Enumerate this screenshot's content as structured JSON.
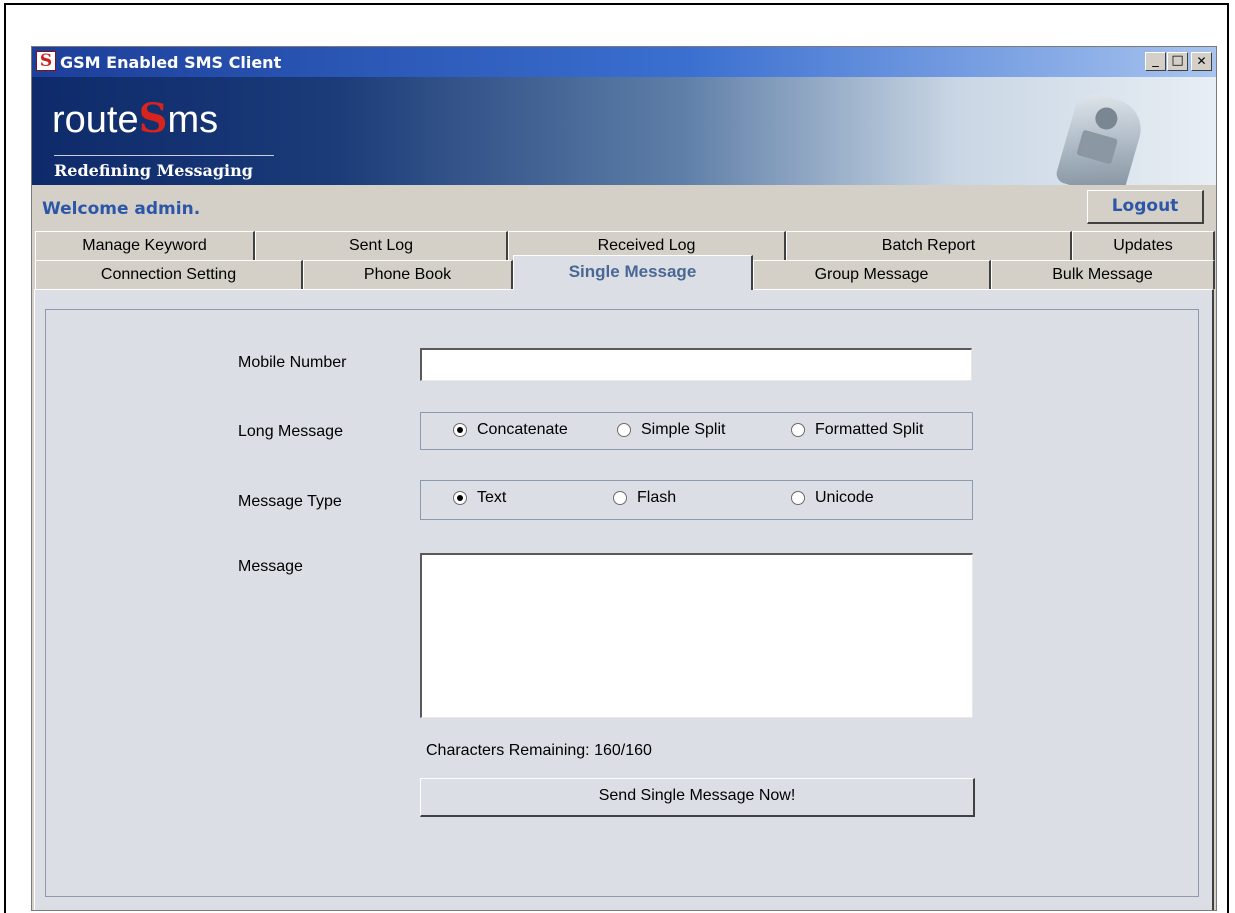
{
  "window": {
    "title": "GSM Enabled SMS Client",
    "app_icon": "S",
    "controls": {
      "minimize": "_",
      "maximize": "□",
      "close": "✕"
    }
  },
  "banner": {
    "brand_left": "route",
    "brand_mark": "S",
    "brand_right": "ms",
    "tagline": "Redefining Messaging"
  },
  "header": {
    "welcome": "Welcome admin.",
    "logout_label": "Logout"
  },
  "tabs": {
    "back_row": [
      {
        "label": "Manage Keyword"
      },
      {
        "label": "Sent Log"
      },
      {
        "label": "Received Log"
      },
      {
        "label": "Batch Report"
      },
      {
        "label": "Updates"
      }
    ],
    "front_row": [
      {
        "label": "Connection Setting"
      },
      {
        "label": "Phone Book"
      },
      {
        "label": "Single Message",
        "active": true
      },
      {
        "label": "Group Message"
      },
      {
        "label": "Bulk Message"
      }
    ]
  },
  "form": {
    "mobile_label": "Mobile Number",
    "mobile_value": "",
    "long_message_label": "Long Message",
    "long_message_options": [
      {
        "label": "Concatenate",
        "checked": true
      },
      {
        "label": "Simple Split",
        "checked": false
      },
      {
        "label": "Formatted Split",
        "checked": false
      }
    ],
    "message_type_label": "Message Type",
    "message_type_options": [
      {
        "label": "Text",
        "checked": true
      },
      {
        "label": "Flash",
        "checked": false
      },
      {
        "label": "Unicode",
        "checked": false
      }
    ],
    "message_label": "Message",
    "message_value": "",
    "chars_remaining": "Characters Remaining: 160/160",
    "send_label": "Send Single Message Now!"
  },
  "colors": {
    "accent_blue": "#2c56a8",
    "active_tab_text": "#4a6894",
    "panel_bg": "#dbdee5",
    "logo_red": "#d8241c"
  }
}
